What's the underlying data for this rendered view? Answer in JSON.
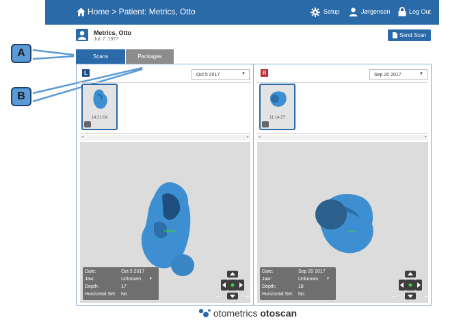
{
  "topbar": {
    "breadcrumb": "Home > Patient: Metrics, Otto",
    "setup_label": "Setup",
    "user_label": "Jørgensen",
    "logout_label": "Log Out"
  },
  "patient": {
    "name": "Metrics, Otto",
    "dob": "Jul. 7. 1977"
  },
  "send_scan_label": "Send Scan",
  "tabs": [
    {
      "label": "Scans",
      "active": true
    },
    {
      "label": "Packages",
      "active": false
    }
  ],
  "callouts": [
    "A",
    "B"
  ],
  "left_panel": {
    "ear": "L",
    "ear_color": "#1a4e8a",
    "date_select": "Oct 5 2017",
    "thumb_time": "14:21:04",
    "info": {
      "date_label": "Date:",
      "date_value": "Oct 5 2017",
      "jaw_label": "Jaw:",
      "jaw_value": "Unknown",
      "depth_label": "Depth:",
      "depth_value": "17",
      "hset_label": "Horizontal Set:",
      "hset_value": "No"
    }
  },
  "right_panel": {
    "ear": "R",
    "ear_color": "#c0282d",
    "date_select": "Sep 20 2017",
    "thumb_time": "11:14:27",
    "info": {
      "date_label": "Date:",
      "date_value": "Sep 20 2017",
      "jaw_label": "Jaw:",
      "jaw_value": "Unknown",
      "depth_label": "Depth:",
      "depth_value": "18",
      "hset_label": "Horizontal Set:",
      "hset_value": "No"
    }
  },
  "footer": {
    "brand": "otometrics",
    "product": "otoscan"
  },
  "colors": {
    "accent": "#2a6aa8",
    "scan_blue": "#3d8fd1"
  }
}
